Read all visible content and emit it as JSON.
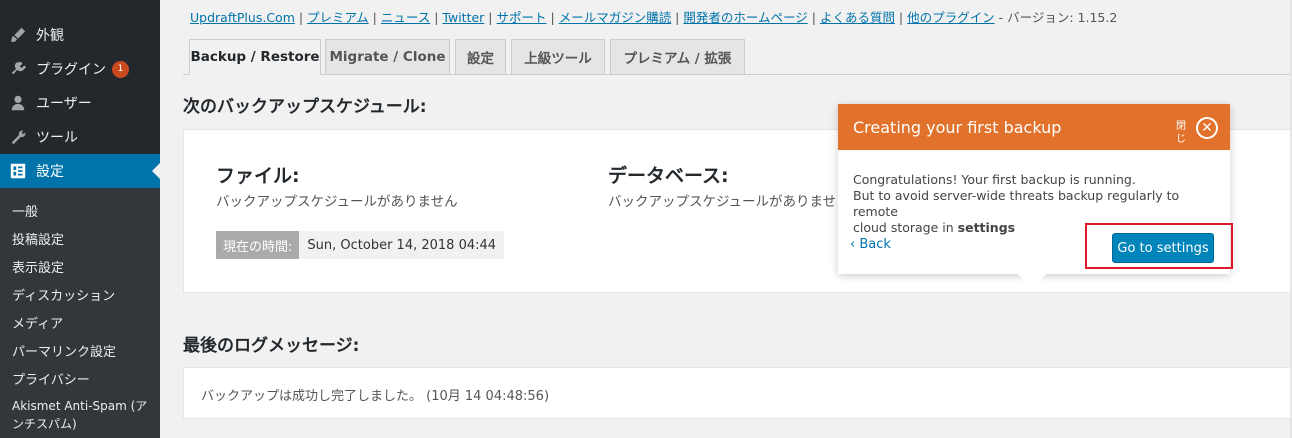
{
  "sidebar": {
    "items": [
      {
        "label": "外観",
        "icon": "paintbrush-icon"
      },
      {
        "label": "プラグイン",
        "icon": "plugin-icon",
        "badge": "1"
      },
      {
        "label": "ユーザー",
        "icon": "user-icon"
      },
      {
        "label": "ツール",
        "icon": "wrench-icon"
      },
      {
        "label": "設定",
        "icon": "settings-icon"
      }
    ],
    "submenu": [
      "一般",
      "投稿設定",
      "表示設定",
      "ディスカッション",
      "メディア",
      "パーマリンク設定",
      "プライバシー",
      "Akismet Anti-Spam (ア",
      "ンチスパム)"
    ]
  },
  "toplinks": {
    "links": [
      "UpdraftPlus.Com",
      "プレミアム",
      "ニュース",
      "Twitter",
      "サポート",
      "メールマガジン購読",
      "開発者のホームページ",
      "よくある質問",
      "他のプラグイン"
    ],
    "separator": " | ",
    "version_prefix": " - バージョン: ",
    "version": "1.15.2"
  },
  "tabs": [
    "Backup / Restore",
    "Migrate / Clone",
    "設定",
    "上級ツール",
    "プレミアム / 拡張"
  ],
  "schedule": {
    "heading": "次のバックアップスケジュール:",
    "files_title": "ファイル:",
    "files_status": "バックアップスケジュールがありません",
    "db_title": "データベース:",
    "db_status": "バックアップスケジュールがありませ",
    "time_label": "現在の時間:",
    "time_value": "Sun, October 14, 2018 04:44"
  },
  "log": {
    "heading": "最後のログメッセージ:",
    "message": "バックアップは成功し完了しました。 (10月 14 04:48:56)"
  },
  "popover": {
    "title": "Creating your first backup",
    "close_text": "閉じ",
    "body_line1": "Congratulations! Your first backup is running.",
    "body_line2": "But to avoid server-wide threats backup regularly to remote",
    "body_line3_prefix": "cloud storage in ",
    "body_line3_bold": "settings",
    "back_label": "Back",
    "button_label": "Go to settings"
  },
  "colors": {
    "sidebar_bg": "#23282d",
    "active_blue": "#0073aa",
    "popover_orange": "#e2722b",
    "highlight_red": "#e0142b"
  }
}
